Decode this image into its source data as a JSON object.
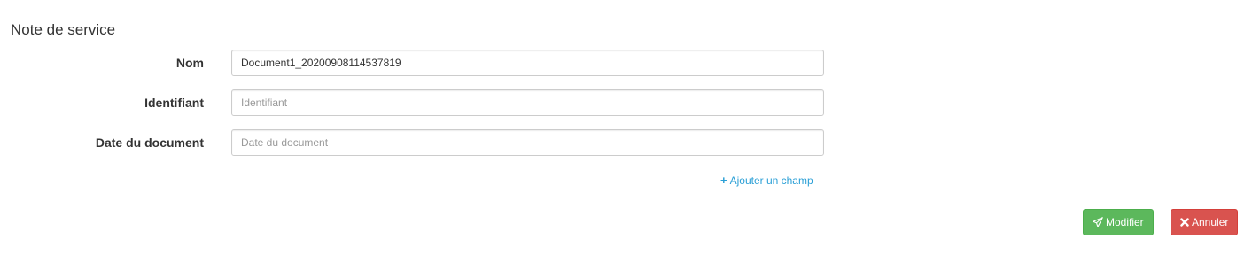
{
  "form": {
    "title": "Note de service",
    "fields": [
      {
        "label": "Nom",
        "value": "Document1_20200908114537819",
        "placeholder": ""
      },
      {
        "label": "Identifiant",
        "value": "",
        "placeholder": "Identifiant"
      },
      {
        "label": "Date du document",
        "value": "",
        "placeholder": "Date du document"
      }
    ],
    "add_field_label": "Ajouter un champ"
  },
  "actions": {
    "submit_label": "Modifier",
    "cancel_label": "Annuler"
  },
  "colors": {
    "link": "#2a9fd6",
    "success": "#5cb85c",
    "danger": "#d9534f"
  },
  "icons": {
    "add_field": "plus-icon",
    "submit": "paper-plane-icon",
    "cancel": "close-icon"
  }
}
